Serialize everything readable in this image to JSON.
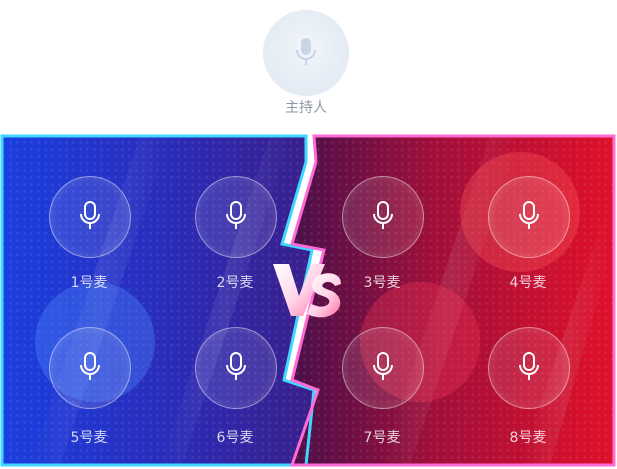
{
  "host": {
    "label": "主持人",
    "icon": "microphone-icon"
  },
  "seats": [
    {
      "id": 1,
      "label": "1号麦",
      "team": "blue",
      "icon": "microphone-icon"
    },
    {
      "id": 2,
      "label": "2号麦",
      "team": "blue",
      "icon": "microphone-icon"
    },
    {
      "id": 3,
      "label": "3号麦",
      "team": "red",
      "icon": "microphone-icon"
    },
    {
      "id": 4,
      "label": "4号麦",
      "team": "red",
      "icon": "microphone-icon"
    },
    {
      "id": 5,
      "label": "5号麦",
      "team": "blue",
      "icon": "microphone-icon"
    },
    {
      "id": 6,
      "label": "6号麦",
      "team": "blue",
      "icon": "microphone-icon"
    },
    {
      "id": 7,
      "label": "7号麦",
      "team": "red",
      "icon": "microphone-icon"
    },
    {
      "id": 8,
      "label": "8号麦",
      "team": "red",
      "icon": "microphone-icon"
    }
  ],
  "colors": {
    "blue_team": "#1f3fd6",
    "red_team": "#e0102a",
    "blue_glow": "#3fd6ff",
    "red_glow": "#ff6ad5"
  }
}
